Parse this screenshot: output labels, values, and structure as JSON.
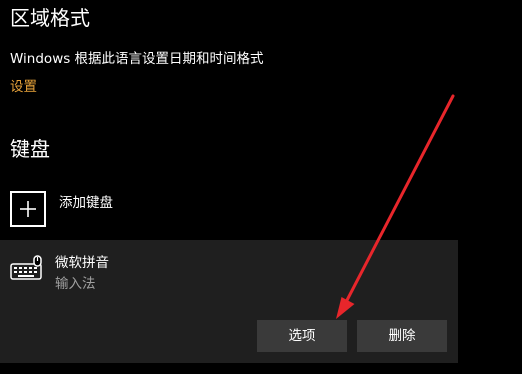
{
  "region_format": {
    "heading": "区域格式",
    "description": "Windows 根据此语言设置日期和时间格式",
    "settings_link": "设置"
  },
  "keyboard": {
    "heading": "键盘",
    "add_label": "添加键盘",
    "add_icon": "plus-icon",
    "ime": {
      "icon": "keyboard-icon",
      "name": "微软拼音",
      "type": "输入法",
      "options_label": "选项",
      "delete_label": "删除"
    }
  },
  "colors": {
    "background": "#000000",
    "panel": "#1f1f1f",
    "button": "#3a3a3a",
    "link": "#e8a33a",
    "annotation_arrow": "#e8262b",
    "secondary_text": "#a0a0a0"
  }
}
